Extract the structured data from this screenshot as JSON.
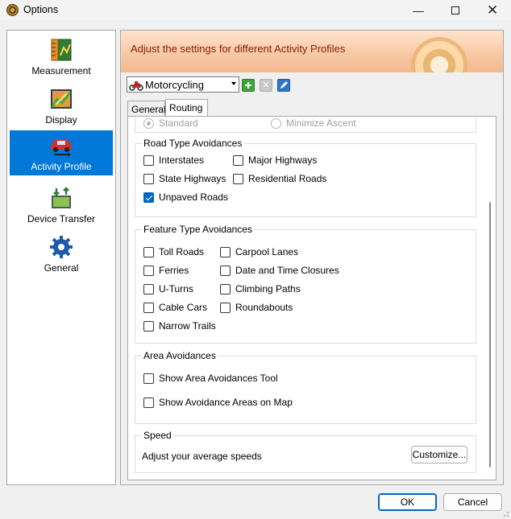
{
  "window": {
    "title": "Options"
  },
  "sidebar": {
    "items": [
      {
        "label": "Measurement",
        "icon": "ruler-icon"
      },
      {
        "label": "Display",
        "icon": "display-icon"
      },
      {
        "label": "Activity Profile",
        "icon": "car-icon",
        "active": true
      },
      {
        "label": "Device Transfer",
        "icon": "device-transfer-icon"
      },
      {
        "label": "General",
        "icon": "gear-icon"
      }
    ]
  },
  "header": {
    "banner_text": "Adjust the settings for different Activity Profiles"
  },
  "profile": {
    "selected": "Motorcycling"
  },
  "tabs": [
    {
      "label": "General"
    },
    {
      "label": "Routing",
      "active": true
    }
  ],
  "routing": {
    "partial_radio": {
      "left_label": "Standard",
      "right_label": "Minimize Ascent"
    },
    "road_type": {
      "title": "Road Type Avoidances",
      "items": [
        {
          "label": "Interstates",
          "checked": false
        },
        {
          "label": "Major Highways",
          "checked": false
        },
        {
          "label": "State Highways",
          "checked": false
        },
        {
          "label": "Residential Roads",
          "checked": false
        },
        {
          "label": "Unpaved Roads",
          "checked": true
        }
      ]
    },
    "feature_type": {
      "title": "Feature Type Avoidances",
      "items": [
        {
          "label": "Toll Roads",
          "checked": false
        },
        {
          "label": "Carpool Lanes",
          "checked": false
        },
        {
          "label": "Ferries",
          "checked": false
        },
        {
          "label": "Date and Time Closures",
          "checked": false
        },
        {
          "label": "U-Turns",
          "checked": false
        },
        {
          "label": "Climbing Paths",
          "checked": false
        },
        {
          "label": "Cable Cars",
          "checked": false
        },
        {
          "label": "Roundabouts",
          "checked": false
        },
        {
          "label": "Narrow Trails",
          "checked": false
        }
      ]
    },
    "area": {
      "title": "Area Avoidances",
      "items": [
        {
          "label": "Show Area Avoidances Tool",
          "checked": false
        },
        {
          "label": "Show Avoidance Areas on Map",
          "checked": false
        }
      ]
    },
    "speed": {
      "title": "Speed",
      "description": "Adjust your average speeds",
      "button": "Customize..."
    }
  },
  "footer": {
    "ok": "OK",
    "cancel": "Cancel"
  },
  "colors": {
    "accent": "#0078d7",
    "banner_text": "#8a1c00"
  }
}
